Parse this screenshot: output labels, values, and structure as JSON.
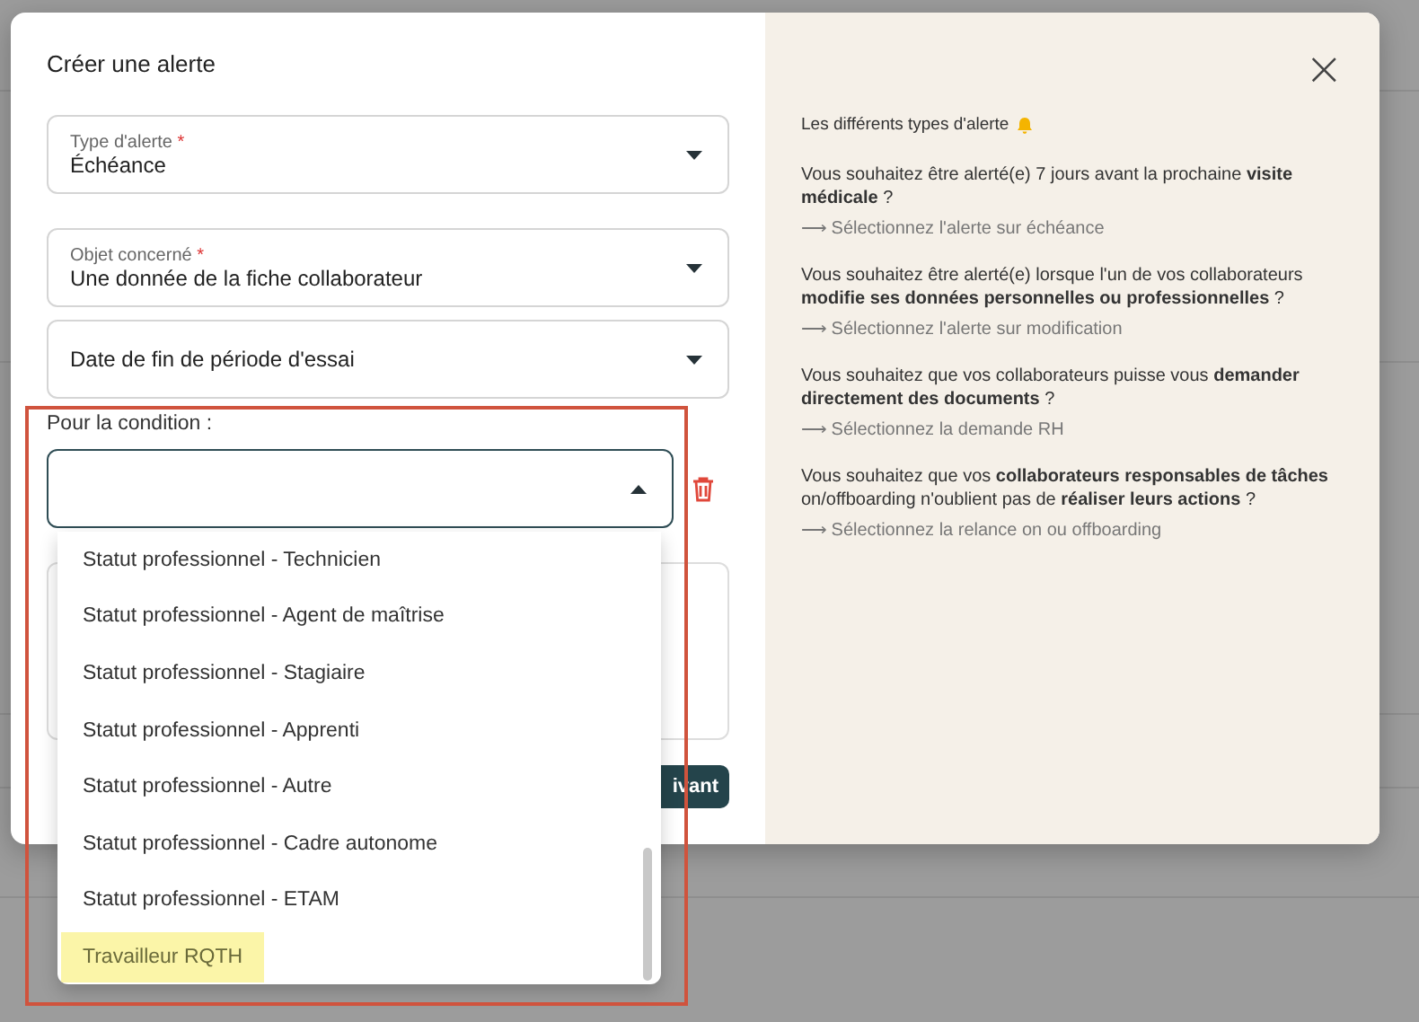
{
  "dialog": {
    "title": "Créer une alerte",
    "close": "×",
    "fields": [
      {
        "label": "Type d'alerte",
        "required_mark": "*",
        "value": "Échéance"
      },
      {
        "label": "Objet concerné",
        "required_mark": "*",
        "value": "Une donnée de la fiche collaborateur"
      },
      {
        "value": "Date de fin de période d'essai"
      }
    ],
    "condition": {
      "label": "Pour la condition :",
      "expanded": true,
      "options": [
        {
          "label": "Statut professionnel - Technicien",
          "highlighted": false
        },
        {
          "label": "Statut professionnel - Agent de maîtrise",
          "highlighted": false
        },
        {
          "label": "Statut professionnel - Stagiaire",
          "highlighted": false
        },
        {
          "label": "Statut professionnel - Apprenti",
          "highlighted": false
        },
        {
          "label": "Statut professionnel - Autre",
          "highlighted": false
        },
        {
          "label": "Statut professionnel - Cadre autonome",
          "highlighted": false
        },
        {
          "label": "Statut professionnel - ETAM",
          "highlighted": false
        },
        {
          "label": "Travailleur RQTH",
          "highlighted": true
        }
      ]
    },
    "next_button": "ivant",
    "help": {
      "title": "Les différents types d'alerte",
      "items": [
        {
          "question": "Vous souhaitez être alerté(e) 7 jours avant la prochaine **visite médicale** ?",
          "hint": "⟶  Sélectionnez l'alerte sur échéance"
        },
        {
          "question": "Vous souhaitez être alerté(e) lorsque l'un de vos collaborateurs **modifie ses données personnelles ou professionnelles** ?",
          "hint": "⟶  Sélectionnez l'alerte sur modification"
        },
        {
          "question": "Vous souhaitez que vos collaborateurs puisse vous **demander directement des documents** ?",
          "hint": "⟶  Sélectionnez la demande RH"
        },
        {
          "question": "Vous souhaitez que vos **collaborateurs responsables de tâches** on/offboarding n'oublient pas de **réaliser leurs actions** ?",
          "hint": "⟶  Sélectionnez la relance on ou offboarding"
        }
      ]
    }
  }
}
